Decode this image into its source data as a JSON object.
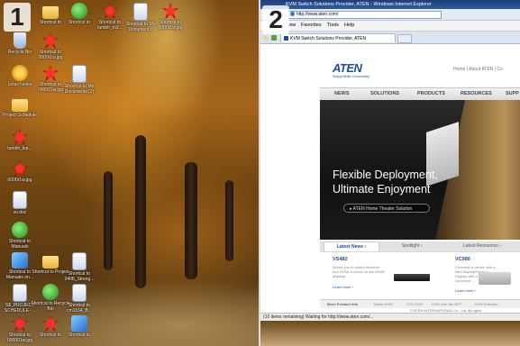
{
  "left_panel": {
    "number": "1",
    "icons": [
      {
        "label": "",
        "icon": "recycle-icon"
      },
      {
        "label": "Recycle Bin",
        "icon": "recycle-icon"
      },
      {
        "label": "Lotus Notes",
        "icon": "lotus-icon"
      },
      {
        "label": "Project Schedule",
        "icon": "folder-icon"
      },
      {
        "label": "tumblr_lep...",
        "icon": "image-icon"
      },
      {
        "label": "0000r1w.jpg",
        "icon": "image-icon"
      },
      {
        "label": "vo.doc",
        "icon": "document-icon"
      },
      {
        "label": "Shortcut to Manuals",
        "icon": "shortcut-icon"
      },
      {
        "label": "Shortcut to Manuals on...",
        "icon": "shortcut-icon"
      },
      {
        "label": "S$_PROJECT SCHEDULE -...",
        "icon": "document-icon"
      },
      {
        "label": "Shortcut to 000001w.jpg",
        "icon": "image-icon"
      },
      {
        "label": "",
        "icon": "shortcut-icon"
      },
      {
        "label": "Shortcut to",
        "icon": "shortcut-icon"
      },
      {
        "label": "Shortcut to 0000r1w.jpg",
        "icon": "image-icon"
      },
      {
        "label": "Shortcut to Project",
        "icon": "shortcut-icon"
      },
      {
        "label": "Shortcut to Recycle Bin",
        "icon": "shortcut-icon"
      },
      {
        "label": "Shortcut to",
        "icon": "image-icon"
      },
      {
        "label": "Shortcut to My Documents (2)",
        "icon": "shortcut-icon"
      },
      {
        "label": "Shortcut to 0408_Streng...",
        "icon": "document-icon"
      },
      {
        "label": "Shortcut to cm1164_B...",
        "icon": "document-icon"
      },
      {
        "label": "Shortcut to tumblr_m2...",
        "icon": "image-icon"
      },
      {
        "label": "Shortcut to My Document...",
        "icon": "document-icon"
      },
      {
        "label": "Shortcut to 0000r1w.jpg",
        "icon": "image-icon"
      }
    ]
  },
  "right_panel": {
    "number": "2",
    "window_title": "KVM Switch Solutions Provider, ATEN - Windows Internet Explorer",
    "address": "http://www.aten.com/",
    "menu": [
      "iew",
      "Favorites",
      "Tools",
      "Help"
    ],
    "tab_label": "KVM Switch Solutions Provider, ATEN",
    "site": {
      "logo": "ATEN",
      "logo_sub": "Simply Better Connectivity",
      "top_links": "Home  |  About ATEN  |  Co",
      "nav": [
        "NEWS",
        "SOLUTIONS",
        "PRODUCTS",
        "RESOURCES",
        "SUPP"
      ],
      "hero_line1": "Flexible Deployment,",
      "hero_line2": "Ultimate Enjoyment",
      "hero_button": "ATEN Home Theater Solution",
      "tabs": [
        "Latest News",
        "Spotlight",
        "Latest Resources"
      ],
      "news": [
        {
          "title": "VS482",
          "text": "Allows you to switch between four HDMI sources on two HDMI displays ...",
          "link": "Learn more"
        },
        {
          "title": "VC980",
          "text": "Connects a device with a Mini DisplayPort to a Display with a HDMI connector ...",
          "link": "Learn more"
        }
      ],
      "products_label": "More Product Info",
      "products": [
        "Matrix KVM",
        "LCD KVM",
        "KVM over the NET",
        "KVM Extender"
      ],
      "copyright": "© ATEN INTERNATIONAL Co., Ltd. All rights"
    },
    "status": "(10 items remaining) Waiting for http://www.aten.com/..."
  }
}
